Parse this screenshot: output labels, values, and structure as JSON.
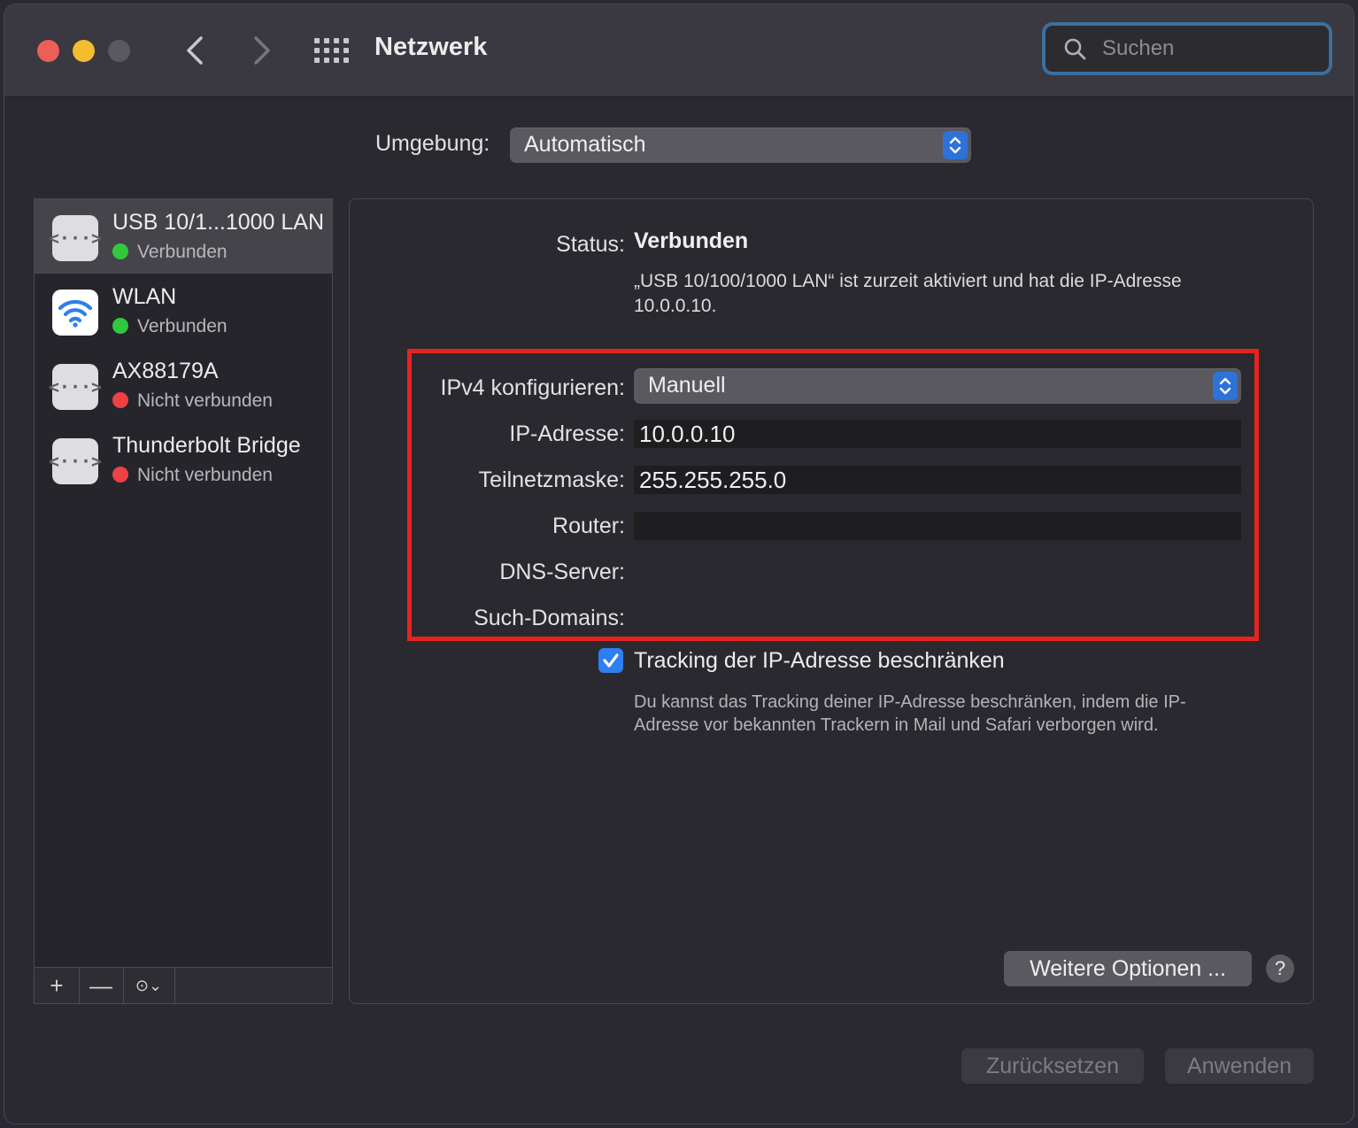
{
  "window": {
    "title": "Netzwerk",
    "search_placeholder": "Suchen"
  },
  "location": {
    "label": "Umgebung:",
    "value": "Automatisch"
  },
  "services": [
    {
      "name": "USB 10/1...1000 LAN",
      "status": "Verbunden",
      "status_color": "#30c93e",
      "icon": "ethernet-icon",
      "selected": true
    },
    {
      "name": "WLAN",
      "status": "Verbunden",
      "status_color": "#30c93e",
      "icon": "wifi-icon",
      "selected": false
    },
    {
      "name": "AX88179A",
      "status": "Nicht verbunden",
      "status_color": "#ee4143",
      "icon": "ethernet-icon",
      "selected": false
    },
    {
      "name": "Thunderbolt Bridge",
      "status": "Nicht verbunden",
      "status_color": "#ee4143",
      "icon": "ethernet-icon",
      "selected": false
    }
  ],
  "sidebar_tools": {
    "add": "+",
    "remove": "—",
    "more": "⊙⌄"
  },
  "detail": {
    "status_label": "Status:",
    "status_value": "Verbunden",
    "status_description": "„USB 10/100/1000 LAN“ ist zurzeit aktiviert und hat die IP-Adresse 10.0.0.10.",
    "ipv4_label": "IPv4 konfigurieren:",
    "ipv4_value": "Manuell",
    "ip_label": "IP-Adresse:",
    "ip_value": "10.0.0.10",
    "subnet_label": "Teilnetzmaske:",
    "subnet_value": "255.255.255.0",
    "router_label": "Router:",
    "router_value": "",
    "dns_label": "DNS-Server:",
    "search_domains_label": "Such-Domains:",
    "tracking_checked": true,
    "tracking_label": "Tracking der IP-Adresse beschränken",
    "tracking_description": "Du kannst das Tracking deiner IP-Adresse beschränken, indem die IP-Adresse vor bekannten Trackern in Mail und Safari verborgen wird.",
    "more_options": "Weitere Optionen ...",
    "help": "?"
  },
  "footer": {
    "reset": "Zurücksetzen",
    "apply": "Anwenden"
  },
  "colors": {
    "highlight_border": "#e8231f",
    "accent": "#2d72d9"
  }
}
